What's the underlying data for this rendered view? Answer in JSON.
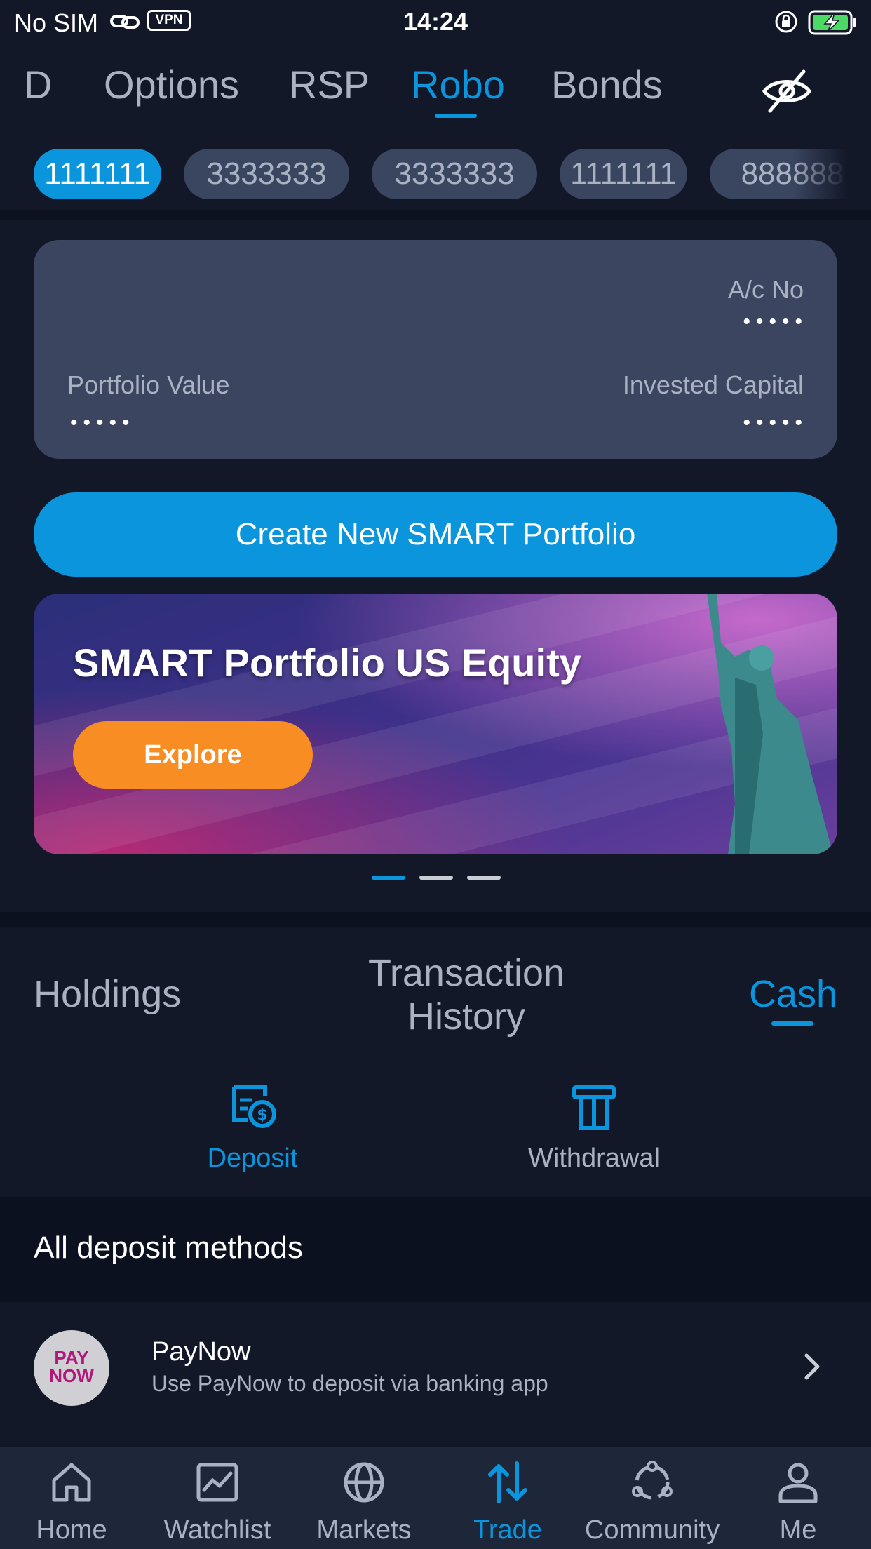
{
  "status_bar": {
    "carrier": "No SIM",
    "vpn_label": "VPN",
    "time": "14:24"
  },
  "top_tabs": {
    "partial": "D",
    "items": [
      "Options",
      "RSP",
      "Robo",
      "Bonds"
    ],
    "active": "Robo",
    "visibility_icon": "eye-off-icon"
  },
  "accounts": {
    "chips": [
      "1111111",
      "3333333",
      "3333333",
      "1111111",
      "888888"
    ],
    "active_index": 0
  },
  "account_card": {
    "acno_label": "A/c No",
    "acno_value": "•••••",
    "portfolio_value_label": "Portfolio Value",
    "portfolio_value": "•••••",
    "invested_capital_label": "Invested Capital",
    "invested_capital": "•••••"
  },
  "create_button": "Create New SMART Portfolio",
  "banner": {
    "title": "SMART Portfolio US Equity",
    "cta": "Explore",
    "pages": 3,
    "active_page": 0
  },
  "section_tabs": {
    "holdings": "Holdings",
    "transaction_line1": "Transaction",
    "transaction_line2": "History",
    "cash": "Cash",
    "active": "Cash"
  },
  "actions": {
    "deposit": "Deposit",
    "withdrawal": "Withdrawal"
  },
  "deposit_methods": {
    "header": "All deposit methods",
    "items": [
      {
        "logo_line1": "PAY",
        "logo_line2": "NOW",
        "title": "PayNow",
        "subtitle": "Use PayNow to deposit via banking app"
      }
    ]
  },
  "bottom_nav": {
    "items": [
      "Home",
      "Watchlist",
      "Markets",
      "Trade",
      "Community",
      "Me"
    ],
    "active": "Trade"
  },
  "colors": {
    "background": "#121828",
    "accent": "#0a95dc",
    "card": "#3c4560",
    "explore": "#f88d24",
    "muted_text": "#a9b1c3"
  }
}
